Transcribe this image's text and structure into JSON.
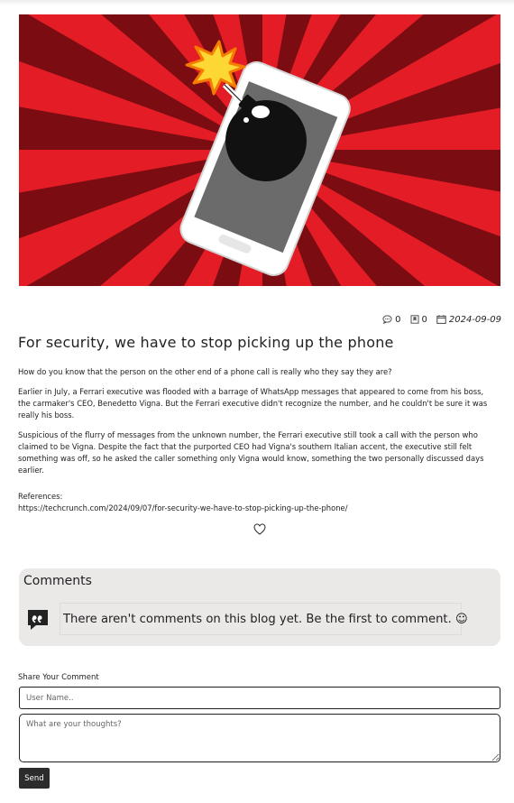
{
  "post": {
    "image_alt": "Illustration of a smartphone with a lit bomb on its screen over a red sunburst background",
    "meta": {
      "comment_count": "0",
      "bookmark_count": "0",
      "date": "2024-09-09"
    },
    "title": "For security, we have to stop picking up the phone",
    "paragraphs": [
      "How do you know that the person on the other end of a phone call is really who they say they are?",
      "Earlier in July, a Ferrari executive was flooded with a barrage of WhatsApp messages that appeared to come from his boss, the carmaker's CEO, Benedetto Vigna. But the Ferrari executive didn't recognize the number, and he couldn't be sure it was really his boss.",
      "Suspicious of the flurry of messages from the unknown number, the Ferrari executive still took a call with the person who claimed to be Vigna. Despite the fact that the purported CEO had Vigna's southern Italian accent, the executive still felt something was off, so he asked the caller something only Vigna would know, something the two personally discussed days earlier."
    ],
    "references_label": "References:",
    "reference_url": "https://techcrunch.com/2024/09/07/for-security-we-have-to-stop-picking-up-the-phone/"
  },
  "comments": {
    "heading": "Comments",
    "empty_message": "There aren't comments on this blog yet. Be the first to comment. ☺"
  },
  "share": {
    "label": "Share Your Comment",
    "name_placeholder": "User Name..",
    "thoughts_placeholder": "What are your thoughts?",
    "send_label": "Send"
  },
  "icons": {
    "comment_count": "speech-bubble-icon",
    "bookmark_count": "bookmark-icon",
    "date": "calendar-icon",
    "like": "heart-icon",
    "comments_section": "quote-bubble-icon"
  },
  "colors": {
    "hero_red": "#e31c25",
    "hero_dark_red": "#7a0c12",
    "panel_bg": "#ebe8e8",
    "button_bg": "#2c2c2c"
  }
}
